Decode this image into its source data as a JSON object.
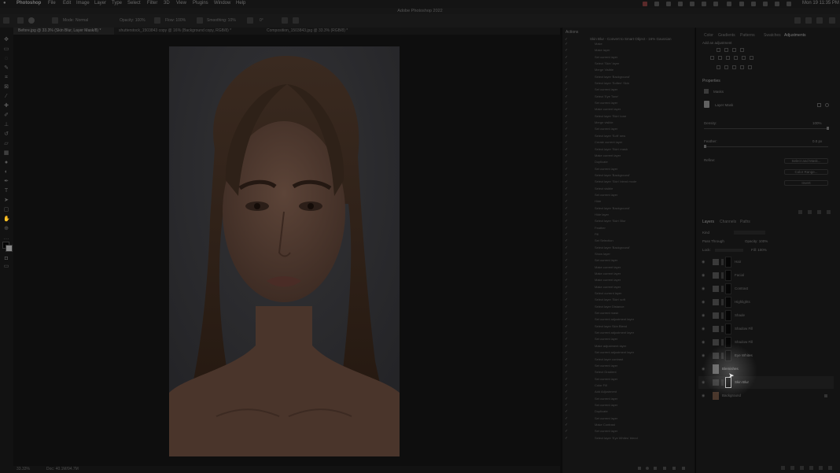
{
  "menubar": {
    "app": "Photoshop",
    "items": [
      "File",
      "Edit",
      "Image",
      "Layer",
      "Type",
      "Select",
      "Filter",
      "3D",
      "View",
      "Plugins",
      "Window",
      "Help"
    ],
    "clock": "Mon 19 11:35 PM"
  },
  "app_title": "Adobe Photoshop 2022",
  "options": {
    "mode_label": "Mode:",
    "mode_value": "Normal",
    "opacity": "Opacity: 100%",
    "flow": "Flow: 100%",
    "smoothing": "Smoothing: 10%",
    "angle": "0°"
  },
  "tabs": [
    "Before.jpg @ 33.3% (Skin Blur, Layer Mask/8) *",
    "shutterstock_1503843 copy @ 16% (Background copy, RGB/8) *",
    "Composition_1503843.jpg @ 33.3% (RGB/8) *"
  ],
  "status": {
    "zoom": "33.33%",
    "doc": "Doc: 40.1M/94.7M"
  },
  "actions": {
    "title": "Actions",
    "set_label": "Skin Blur - Convert to Smart Object - 16% Gaussian",
    "items": [
      "Make",
      "Make layer",
      "Set current layer",
      "Select 'Skin' layer",
      "Merge Visible",
      "Select layer 'Background'",
      "Select layer 'Soften' Skin",
      "Set current layer",
      "Select 'Eye Tone'",
      "Set current layer",
      "Make current layer",
      "Select layer 'Skin' tone",
      "Merge visible",
      "Set current layer",
      "Select layer 'Soft' new",
      "Create current layer",
      "Select layer 'Skin' mask",
      "Make current layer",
      "Duplicate",
      "Set current layer",
      "Select layer 'Background'",
      "Select layer 'Skin' blend mode",
      "Select visible",
      "Set current layer",
      "Hide",
      "Select layer 'Background'",
      "Hide layer",
      "Select layer 'Skin' Blur",
      "Feather",
      "Fill",
      "Set Selection",
      "Select layer 'Background'",
      "Show layer",
      "Set current layer",
      "Make current layer",
      "Make current layer",
      "Make current layer",
      "Make current layer",
      "Select current layer",
      "Select layer 'Skin' soft",
      "Select layer Distance",
      "Set current mask",
      "Set current adjustment layer",
      "Select layer Skin Blend",
      "Set current adjustment layer",
      "Set current layer",
      "Make adjustment layer",
      "Set current adjustment layer",
      "Select layer contrast",
      "Set current layer",
      "Select Gradient",
      "Set current layer",
      "Color Fill",
      "Add Adjustment",
      "Set current layer",
      "Set current layer",
      "Duplicate",
      "Set current layer",
      "Make Contrast",
      "Set current layer",
      "Select layer 'Eye Whites' blend"
    ]
  },
  "right_tabs": [
    "Color",
    "Gradients",
    "Patterns",
    "Swatches",
    "Adjustments"
  ],
  "adjustments_hint": "Add an adjustment",
  "properties": {
    "title": "Properties",
    "kind": "Masks",
    "mask_label": "Layer Mask",
    "density": "Density:",
    "density_val": "100%",
    "feather": "Feather:",
    "feather_val": "0.0 px",
    "refine": "Refine:",
    "buttons": [
      "Select and Mask...",
      "Color Range...",
      "Invert"
    ]
  },
  "layers": {
    "tabs": [
      "Layers",
      "Channels",
      "Paths"
    ],
    "kind": "Kind",
    "blend": "Pass Through",
    "opacity": "Opacity: 100%",
    "lock": "Lock:",
    "fill": "Fill: 100%",
    "items": [
      {
        "name": "Hair"
      },
      {
        "name": "Facial"
      },
      {
        "name": "Contrast"
      },
      {
        "name": "Highlights"
      },
      {
        "name": "Shade"
      },
      {
        "name": "Shadow Fill"
      },
      {
        "name": "Shadow Fill"
      },
      {
        "name": "Eye Whites"
      },
      {
        "name": "Blemishes"
      },
      {
        "name": "Skin Blur"
      },
      {
        "name": "Background"
      }
    ]
  }
}
